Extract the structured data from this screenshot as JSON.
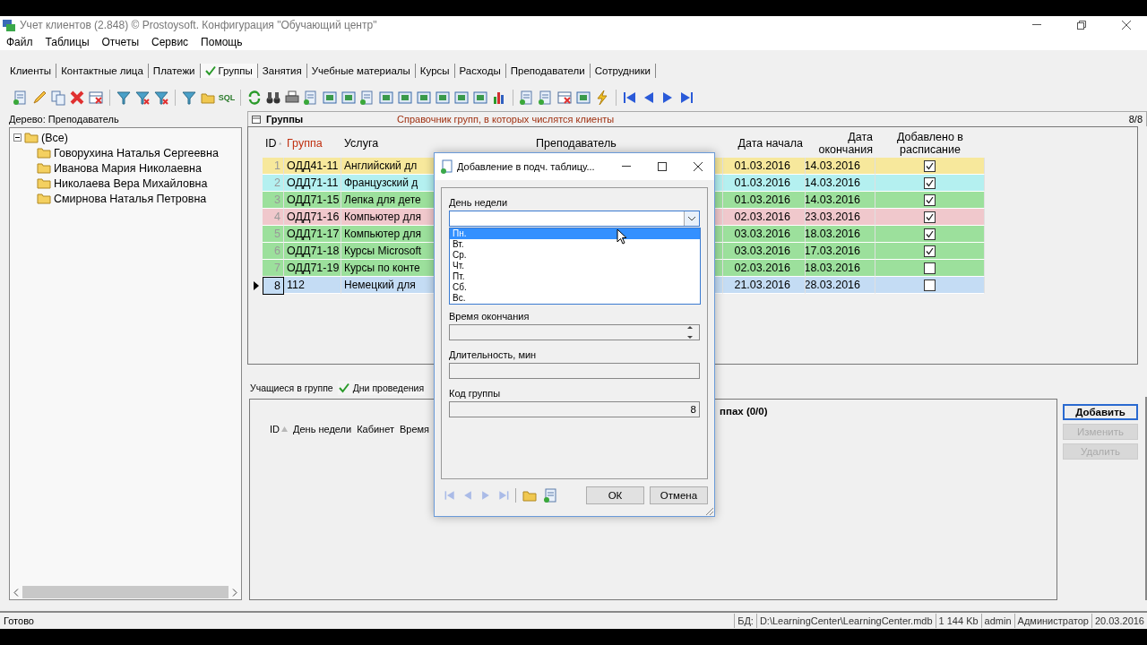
{
  "window": {
    "title": "Учет клиентов (2.848) © Prostoysoft. Конфигурация \"Обучающий центр\""
  },
  "menu": [
    "Файл",
    "Таблицы",
    "Отчеты",
    "Сервис",
    "Помощь"
  ],
  "tabs": [
    {
      "label": "Клиенты",
      "selected": false
    },
    {
      "label": "Контактные лица",
      "selected": false
    },
    {
      "label": "Платежи",
      "selected": false
    },
    {
      "label": "Группы",
      "selected": true
    },
    {
      "label": "Занятия",
      "selected": false
    },
    {
      "label": "Учебные материалы",
      "selected": false
    },
    {
      "label": "Курсы",
      "selected": false
    },
    {
      "label": "Расходы",
      "selected": false
    },
    {
      "label": "Преподаватели",
      "selected": false
    },
    {
      "label": "Сотрудники",
      "selected": false
    }
  ],
  "toolbar": {
    "sql_icon_text": "SQL"
  },
  "tree": {
    "title": "Дерево: Преподаватель",
    "root": {
      "label": "(Все)",
      "expanded": true,
      "children": [
        {
          "label": "Говорухина Наталья Сергеевна"
        },
        {
          "label": "Иванова Мария Николаевна"
        },
        {
          "label": "Николаева Вера Михайловна"
        },
        {
          "label": "Смирнова Наталья Петровна"
        }
      ]
    }
  },
  "groups": {
    "title": "Группы",
    "description": "Справочник групп, в которых числятся клиенты",
    "count": "8/8",
    "columns": [
      {
        "label": "ID",
        "sorted": true,
        "accent": false
      },
      {
        "label": "Группа",
        "sorted": false,
        "accent": true
      },
      {
        "label": "Услуга",
        "sorted": false,
        "accent": false
      },
      {
        "label": "Преподаватель",
        "sorted": false,
        "accent": false
      },
      {
        "label": "Дата начала",
        "sorted": false,
        "accent": false
      },
      {
        "label": "Дата окончания",
        "sorted": false,
        "accent": false
      },
      {
        "label": "Добавлено в расписание",
        "sorted": false,
        "accent": false
      }
    ],
    "rows": [
      {
        "id": "1",
        "group": "ОДД41-11",
        "service": "Английский дл",
        "start": "01.03.2016",
        "end": "14.03.2016",
        "added": true,
        "color": "#f7e89c",
        "selected": false
      },
      {
        "id": "2",
        "group": "ОДД71-11",
        "service": "Французский д",
        "start": "01.03.2016",
        "end": "14.03.2016",
        "added": true,
        "color": "#b4f0f0",
        "selected": false
      },
      {
        "id": "3",
        "group": "ОДД71-15",
        "service": "Лепка для дете",
        "start": "01.03.2016",
        "end": "14.03.2016",
        "added": true,
        "color": "#9ce09c",
        "selected": false
      },
      {
        "id": "4",
        "group": "ОДД71-16",
        "service": "Компьютер для",
        "start": "02.03.2016",
        "end": "23.03.2016",
        "added": true,
        "color": "#f0c8cc",
        "selected": false
      },
      {
        "id": "5",
        "group": "ОДД71-17",
        "service": "Компьютер для",
        "start": "03.03.2016",
        "end": "18.03.2016",
        "added": true,
        "color": "#9ce09c",
        "selected": false
      },
      {
        "id": "6",
        "group": "ОДД71-18",
        "service": "Курсы Microsoft",
        "start": "03.03.2016",
        "end": "17.03.2016",
        "added": true,
        "color": "#9ce09c",
        "selected": false
      },
      {
        "id": "7",
        "group": "ОДД71-19",
        "service": "Курсы по конте",
        "start": "02.03.2016",
        "end": "18.03.2016",
        "added": false,
        "color": "#9ce09c",
        "selected": false
      },
      {
        "id": "8",
        "group": "112",
        "service": "Немецкий для",
        "start": "21.03.2016",
        "end": "28.03.2016",
        "added": false,
        "color": "#c4dcf4",
        "selected": true
      }
    ]
  },
  "details": {
    "tabs": [
      {
        "label": "Учащиеся в группе",
        "selected": false
      },
      {
        "label": "Дни проведения",
        "selected": true
      }
    ],
    "columns": [
      {
        "label": "ID",
        "sorted": true
      },
      {
        "label": "День недели",
        "sorted": false
      },
      {
        "label": "Кабинет",
        "sorted": false
      },
      {
        "label": "Время",
        "sorted": false
      }
    ],
    "caption": "ппах (0/0)",
    "buttons": [
      {
        "label": "Добавить",
        "disabled": false
      },
      {
        "label": "Изменить",
        "disabled": true
      },
      {
        "label": "Удалить",
        "disabled": true
      }
    ]
  },
  "dialog": {
    "title": "Добавление в подч. таблицу...",
    "fields": [
      {
        "kind": "combo",
        "label": "День недели",
        "expanded": true,
        "options": [
          {
            "label": "Пн.",
            "selected": true
          },
          {
            "label": "Вт.",
            "selected": false
          },
          {
            "label": "Ср.",
            "selected": false
          },
          {
            "label": "Чт.",
            "selected": false
          },
          {
            "label": "Пт.",
            "selected": false
          },
          {
            "label": "Сб.",
            "selected": false
          },
          {
            "label": "Вс.",
            "selected": false
          }
        ]
      },
      {
        "kind": "spin",
        "label": "Время окончания"
      },
      {
        "kind": "text",
        "label": "Длительность, мин"
      },
      {
        "kind": "text",
        "label": "Код группы",
        "value": "8"
      }
    ],
    "buttons": [
      "ОК",
      "Отмена"
    ]
  },
  "status_bar": {
    "message": "Готово",
    "db_label": "БД:",
    "db_path": "D:\\LearningCenter\\LearningCenter.mdb",
    "size": "1 144 Kb",
    "user": "admin",
    "role": "Администратор",
    "date": "20.03.2016"
  }
}
